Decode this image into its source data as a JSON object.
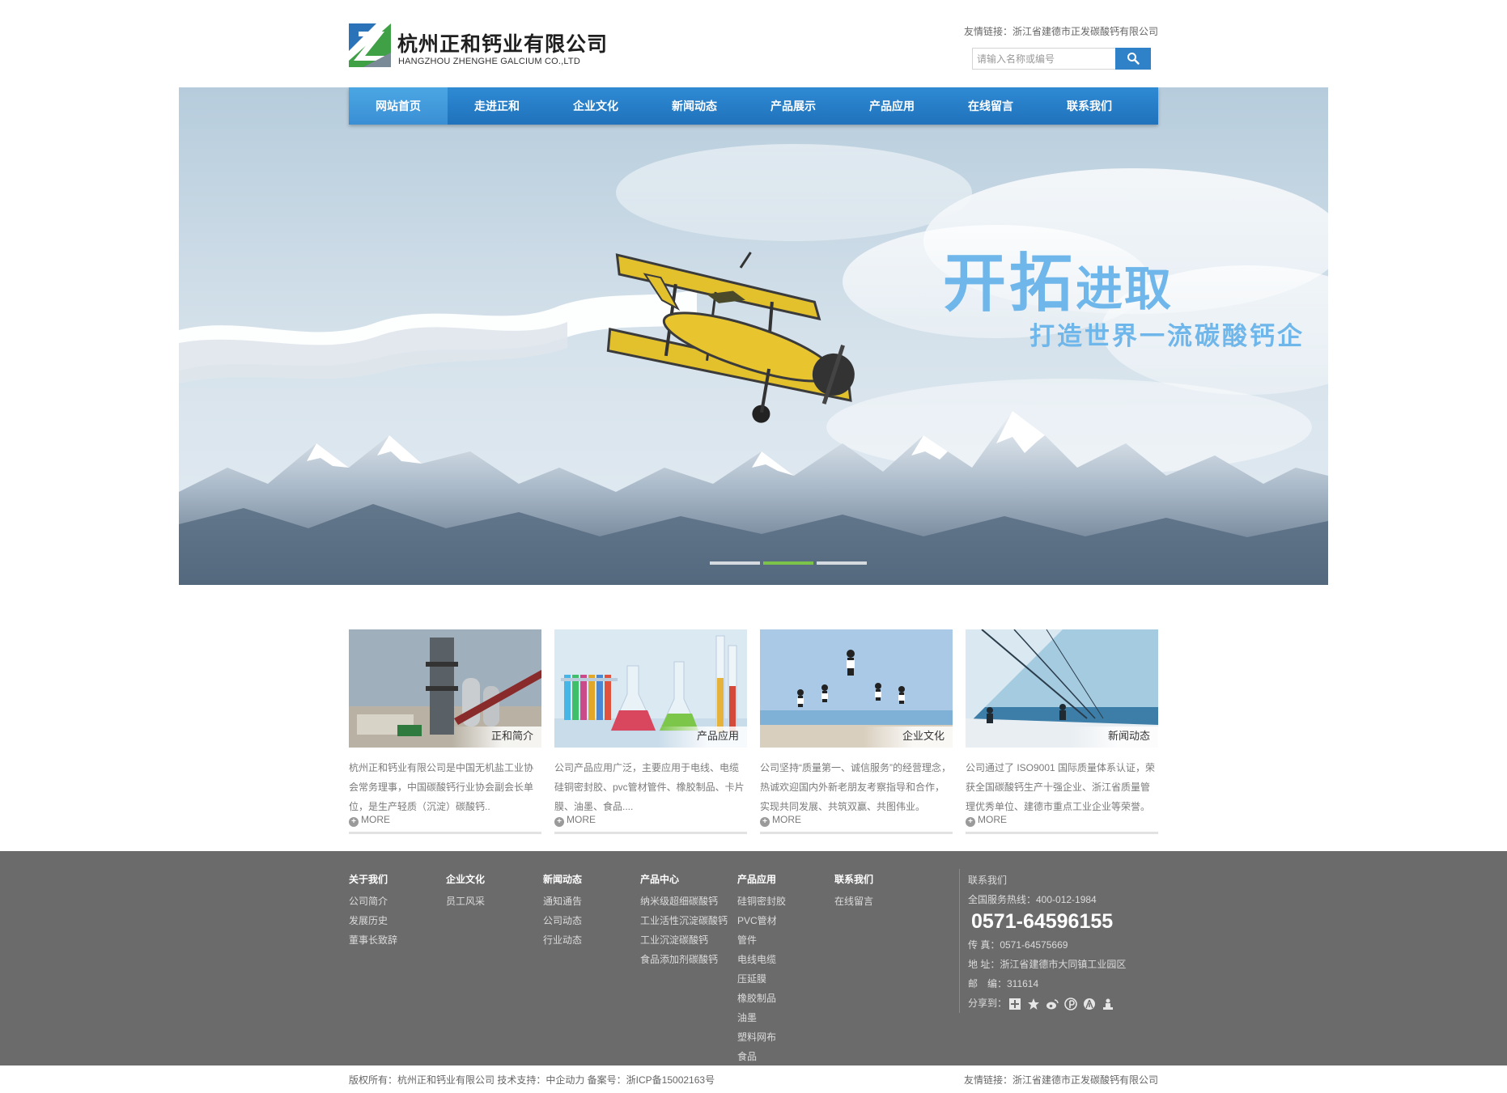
{
  "header": {
    "logo_cn": "杭州正和钙业有限公司",
    "logo_en": "HANGZHOU ZHENGHE GALCIUM CO.,LTD",
    "friend_link": "友情链接：浙江省建德市正发碳酸钙有限公司",
    "search_placeholder": "请输入名称或编号",
    "colors": {
      "logo_green": "#3fa046",
      "logo_blue": "#2a73b9"
    }
  },
  "nav": {
    "items": [
      {
        "label": "网站首页",
        "active": true
      },
      {
        "label": "走进正和"
      },
      {
        "label": "企业文化"
      },
      {
        "label": "新闻动态"
      },
      {
        "label": "产品展示"
      },
      {
        "label": "产品应用"
      },
      {
        "label": "在线留言"
      },
      {
        "label": "联系我们"
      }
    ],
    "colors": {
      "bar": "#2480c6",
      "active": "#45a0e0"
    }
  },
  "banner": {
    "slogan_big": "开拓",
    "slogan_small": "进取",
    "slogan_sub": "打造世界一流碳酸钙企",
    "slide_count": 3,
    "active_slide": 1,
    "colors": {
      "slogan": "#6fb6ea",
      "active_dot": "#7cc34a"
    }
  },
  "cards": [
    {
      "caption": "正和简介",
      "text": "杭州正和钙业有限公司是中国无机盐工业协会常务理事，中国碳酸钙行业协会副会长单位，是生产轻质（沉淀）碳酸钙..",
      "more": "MORE"
    },
    {
      "caption": "产品应用",
      "text": "公司产品应用广泛，主要应用于电线、电缆硅铜密封胶、pvc管材管件、橡胶制品、卡片膜、油墨、食品....",
      "more": "MORE"
    },
    {
      "caption": "企业文化",
      "text": "公司坚持“质量第一、诚信服务”的经营理念，热诚欢迎国内外新老朋友考察指导和合作，实现共同发展、共筑双赢、共图伟业。",
      "more": "MORE"
    },
    {
      "caption": "新闻动态",
      "text": "公司通过了 ISO9001 国际质量体系认证，荣获全国碳酸钙生产十强企业、浙江省质量管理优秀单位、建德市重点工业企业等荣誉。",
      "more": "MORE"
    }
  ],
  "footer": {
    "columns": [
      {
        "title": "关于我们",
        "items": [
          "公司简介",
          "发展历史",
          "董事长致辞"
        ]
      },
      {
        "title": "企业文化",
        "items": [
          "员工风采"
        ]
      },
      {
        "title": "新闻动态",
        "items": [
          "通知通告",
          "公司动态",
          "行业动态"
        ]
      },
      {
        "title": "产品中心",
        "items": [
          "纳米级超细碳酸钙",
          "工业活性沉淀碳酸钙",
          "工业沉淀碳酸钙",
          "食品添加剂碳酸钙"
        ]
      },
      {
        "title": "产品应用",
        "items": [
          "硅铜密封胶",
          "PVC管材",
          "管件",
          "电线电缆",
          "压延膜",
          "橡胶制品",
          "油墨",
          "塑料网布",
          "食品"
        ]
      },
      {
        "title": "联系我们",
        "items": [
          "在线留言"
        ]
      }
    ],
    "contact": {
      "title": "联系我们",
      "hotline": "全国服务热线：400-012-1984",
      "phone": "0571-64596155",
      "fax": "传 真：0571-64575669",
      "address": "地 址：浙江省建德市大同镇工业园区",
      "postcode": "邮　编：311614",
      "share_label": "分享到：",
      "share_icons": [
        "plus-share-icon",
        "star-share-icon",
        "weibo-share-icon",
        "pinterest-share-icon",
        "renren-share-icon",
        "people-share-icon"
      ]
    },
    "colors": {
      "background": "#6b6b6b"
    }
  },
  "bottom": {
    "copyright": "版权所有：杭州正和钙业有限公司 技术支持：中企动力 备案号：浙ICP备15002163号",
    "friend_link": "友情链接：浙江省建德市正发碳酸钙有限公司"
  }
}
